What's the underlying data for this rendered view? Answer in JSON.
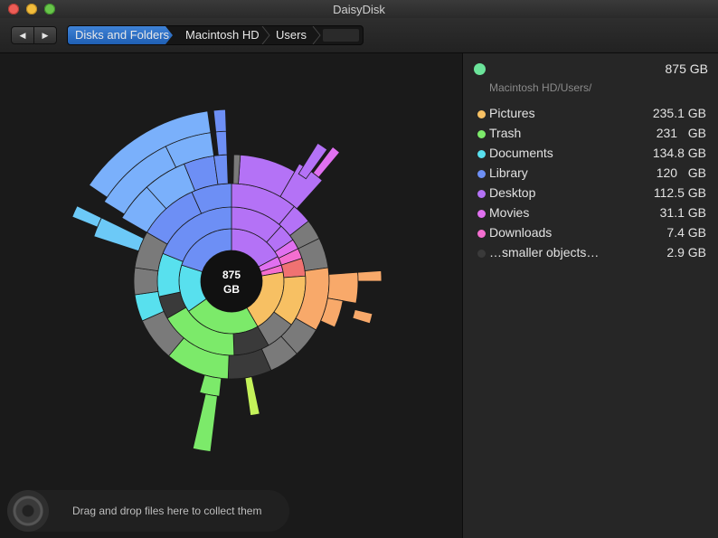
{
  "window": {
    "title": "DaisyDisk"
  },
  "nav": {
    "back_glyph": "◀",
    "forward_glyph": "▶"
  },
  "breadcrumb": [
    {
      "label": "Disks and Folders"
    },
    {
      "label": "Macintosh HD"
    },
    {
      "label": "Users"
    }
  ],
  "center": {
    "size": "875",
    "unit": "GB"
  },
  "drop_zone": {
    "text": "Drag and drop files here to collect them"
  },
  "panel": {
    "total_size": "875 GB",
    "total_color": "#6be39a",
    "path": "Macintosh HD/Users/",
    "items": [
      {
        "label": "Pictures",
        "size": "235.1 GB",
        "color": "#f7c063"
      },
      {
        "label": "Trash",
        "size": "231   GB",
        "color": "#7cea6a"
      },
      {
        "label": "Documents",
        "size": "134.8 GB",
        "color": "#58e0ee"
      },
      {
        "label": "Library",
        "size": "120   GB",
        "color": "#6d8ff5"
      },
      {
        "label": "Desktop",
        "size": "112.5 GB",
        "color": "#b472f6"
      },
      {
        "label": "Movies",
        "size": "31.1 GB",
        "color": "#e070f0"
      },
      {
        "label": "Downloads",
        "size": "7.4 GB",
        "color": "#f46ed0"
      },
      {
        "label": "…smaller objects…",
        "size": "2.9 GB",
        "color": "#3a3a3a"
      }
    ]
  },
  "colors": {
    "library": "#6d8ff5",
    "library_light": "#7ab0fb",
    "library_cyan": "#6cc9f7",
    "desktop": "#b472f6",
    "movies": "#e070f0",
    "downloads": "#f46ed0",
    "red": "#f07272",
    "pictures": "#f7c063",
    "pictures_outer": "#f8a96a",
    "trash": "#7cea6a",
    "trash_light": "#c4f25a",
    "documents": "#58e0ee",
    "grey": "#7a7a7a",
    "dark": "#3a3a3a"
  }
}
